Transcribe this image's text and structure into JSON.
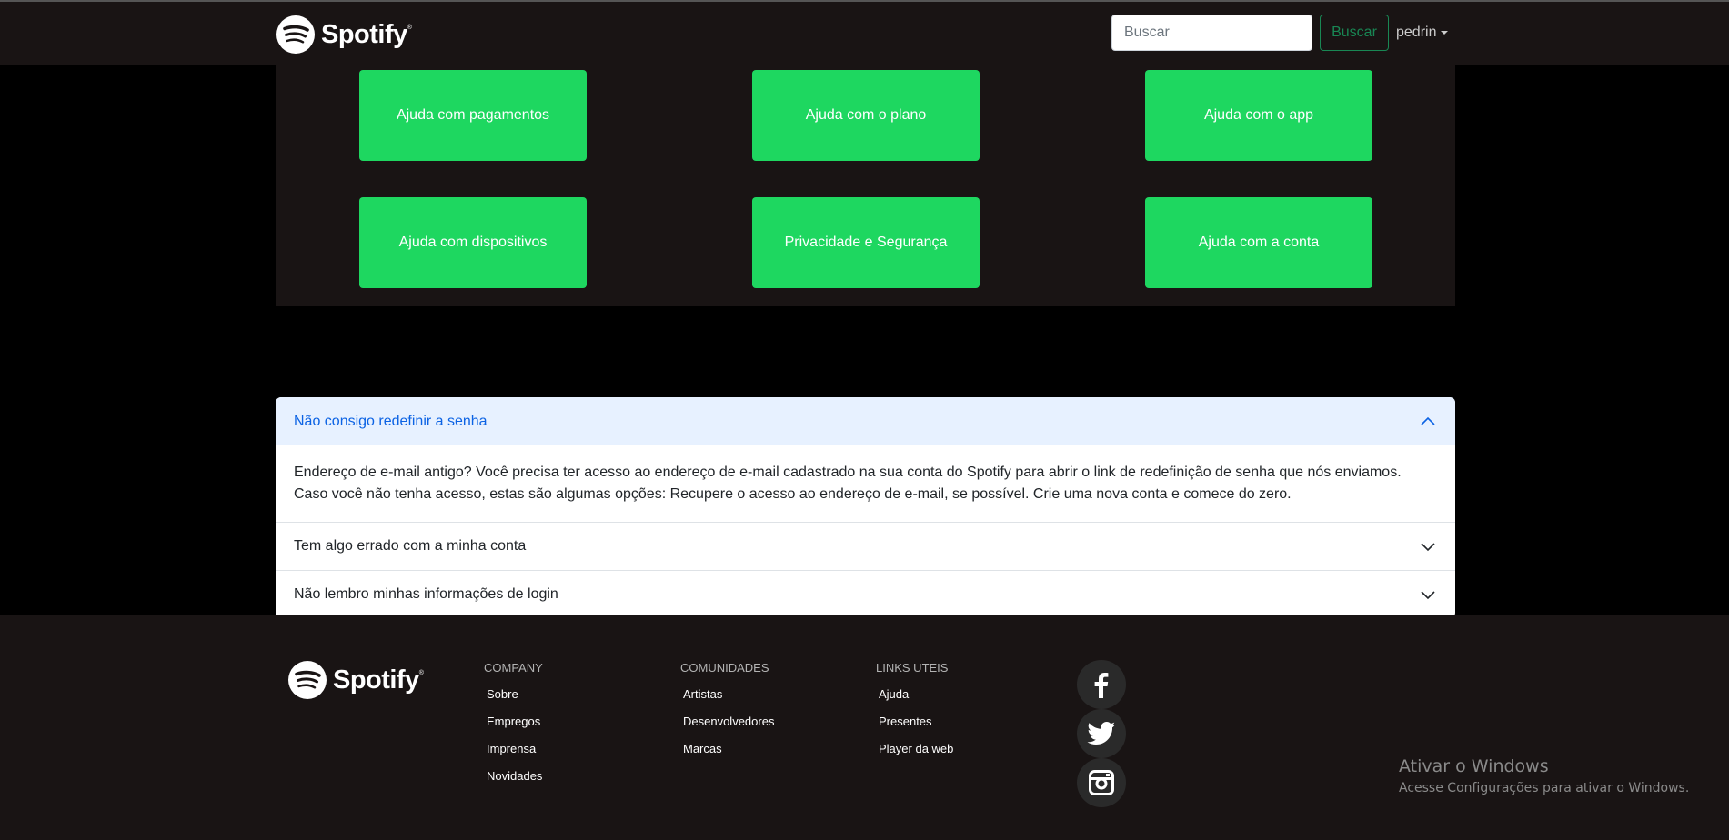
{
  "header": {
    "brand": "Spotify",
    "search_placeholder": "Buscar",
    "search_button": "Buscar",
    "user": "pedrin"
  },
  "help_cards": [
    "Ajuda com pagamentos",
    "Ajuda com o plano",
    "Ajuda com o app",
    "Ajuda com dispositivos",
    "Privacidade e Segurança",
    "Ajuda com a conta"
  ],
  "faq": [
    {
      "question": "Não consigo redefinir a senha",
      "answer": "Endereço de e-mail antigo? Você precisa ter acesso ao endereço de e-mail cadastrado na sua conta do Spotify para abrir o link de redefinição de senha que nós enviamos. Caso você não tenha acesso, estas são algumas opções: Recupere o acesso ao endereço de e-mail, se possível. Crie uma nova conta e comece do zero.",
      "expanded": true
    },
    {
      "question": "Tem algo errado com a minha conta",
      "expanded": false
    },
    {
      "question": "Não lembro minhas informações de login",
      "expanded": false
    }
  ],
  "footer": {
    "brand": "Spotify",
    "columns": [
      {
        "heading": "COMPANY",
        "links": [
          "Sobre",
          "Empregos",
          "Imprensa",
          "Novidades"
        ]
      },
      {
        "heading": "COMUNIDADES",
        "links": [
          "Artistas",
          "Desenvolvedores",
          "Marcas"
        ]
      },
      {
        "heading": "LINKS UTEIS",
        "links": [
          "Ajuda",
          "Presentes",
          "Player da web"
        ]
      }
    ],
    "social": [
      "facebook-icon",
      "twitter-icon",
      "instagram-icon"
    ]
  },
  "watermark": {
    "title": "Ativar o Windows",
    "subtitle": "Acesse Configurações para ativar o Windows."
  },
  "colors": {
    "brand_green": "#1ed760",
    "dark_bg": "#191414",
    "accordion_active": "#0c63e4"
  }
}
